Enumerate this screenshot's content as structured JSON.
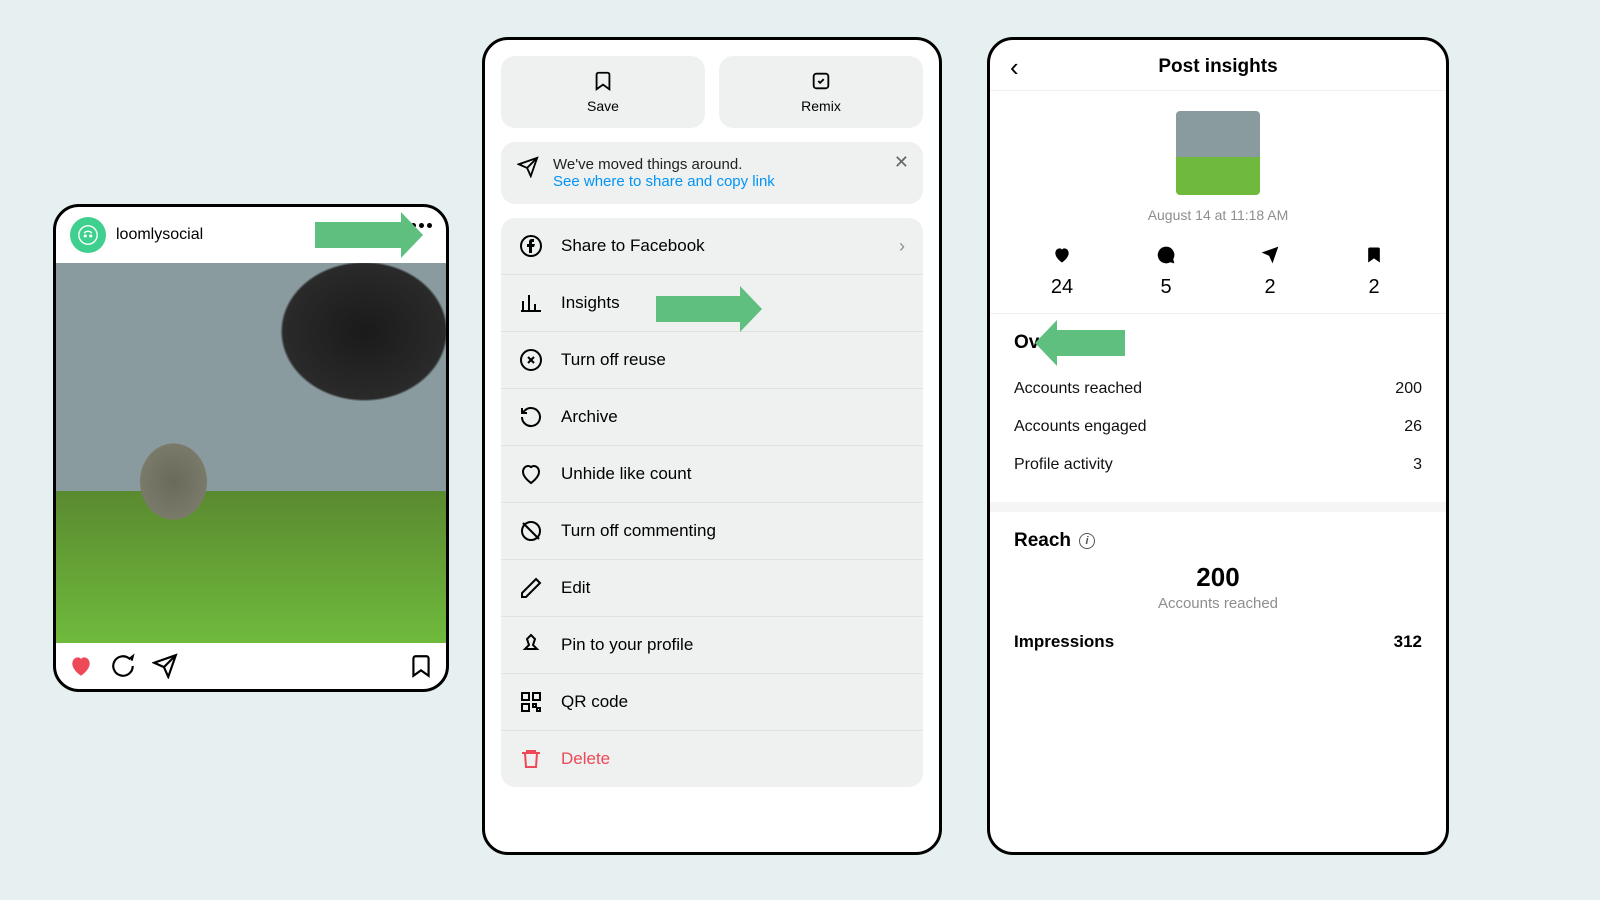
{
  "panel1": {
    "username": "loomlysocial"
  },
  "panel2": {
    "pills": {
      "save": "Save",
      "remix": "Remix"
    },
    "notice": {
      "line1": "We've moved things around.",
      "line2": "See where to share and copy link"
    },
    "items": {
      "share_fb": "Share to Facebook",
      "insights": "Insights",
      "turn_off_reuse": "Turn off reuse",
      "archive": "Archive",
      "unhide_likes": "Unhide like count",
      "turn_off_commenting": "Turn off commenting",
      "edit": "Edit",
      "pin": "Pin to your profile",
      "qr": "QR code",
      "delete": "Delete"
    }
  },
  "panel3": {
    "title": "Post insights",
    "timestamp": "August 14 at 11:18 AM",
    "stats": {
      "likes": "24",
      "comments": "5",
      "shares": "2",
      "saves": "2"
    },
    "overview": {
      "heading": "Overview",
      "rows": {
        "accounts_reached_label": "Accounts reached",
        "accounts_reached_value": "200",
        "accounts_engaged_label": "Accounts engaged",
        "accounts_engaged_value": "26",
        "profile_activity_label": "Profile activity",
        "profile_activity_value": "3"
      }
    },
    "reach": {
      "heading": "Reach",
      "big_number": "200",
      "big_label": "Accounts reached"
    },
    "impressions": {
      "label": "Impressions",
      "value": "312"
    }
  }
}
